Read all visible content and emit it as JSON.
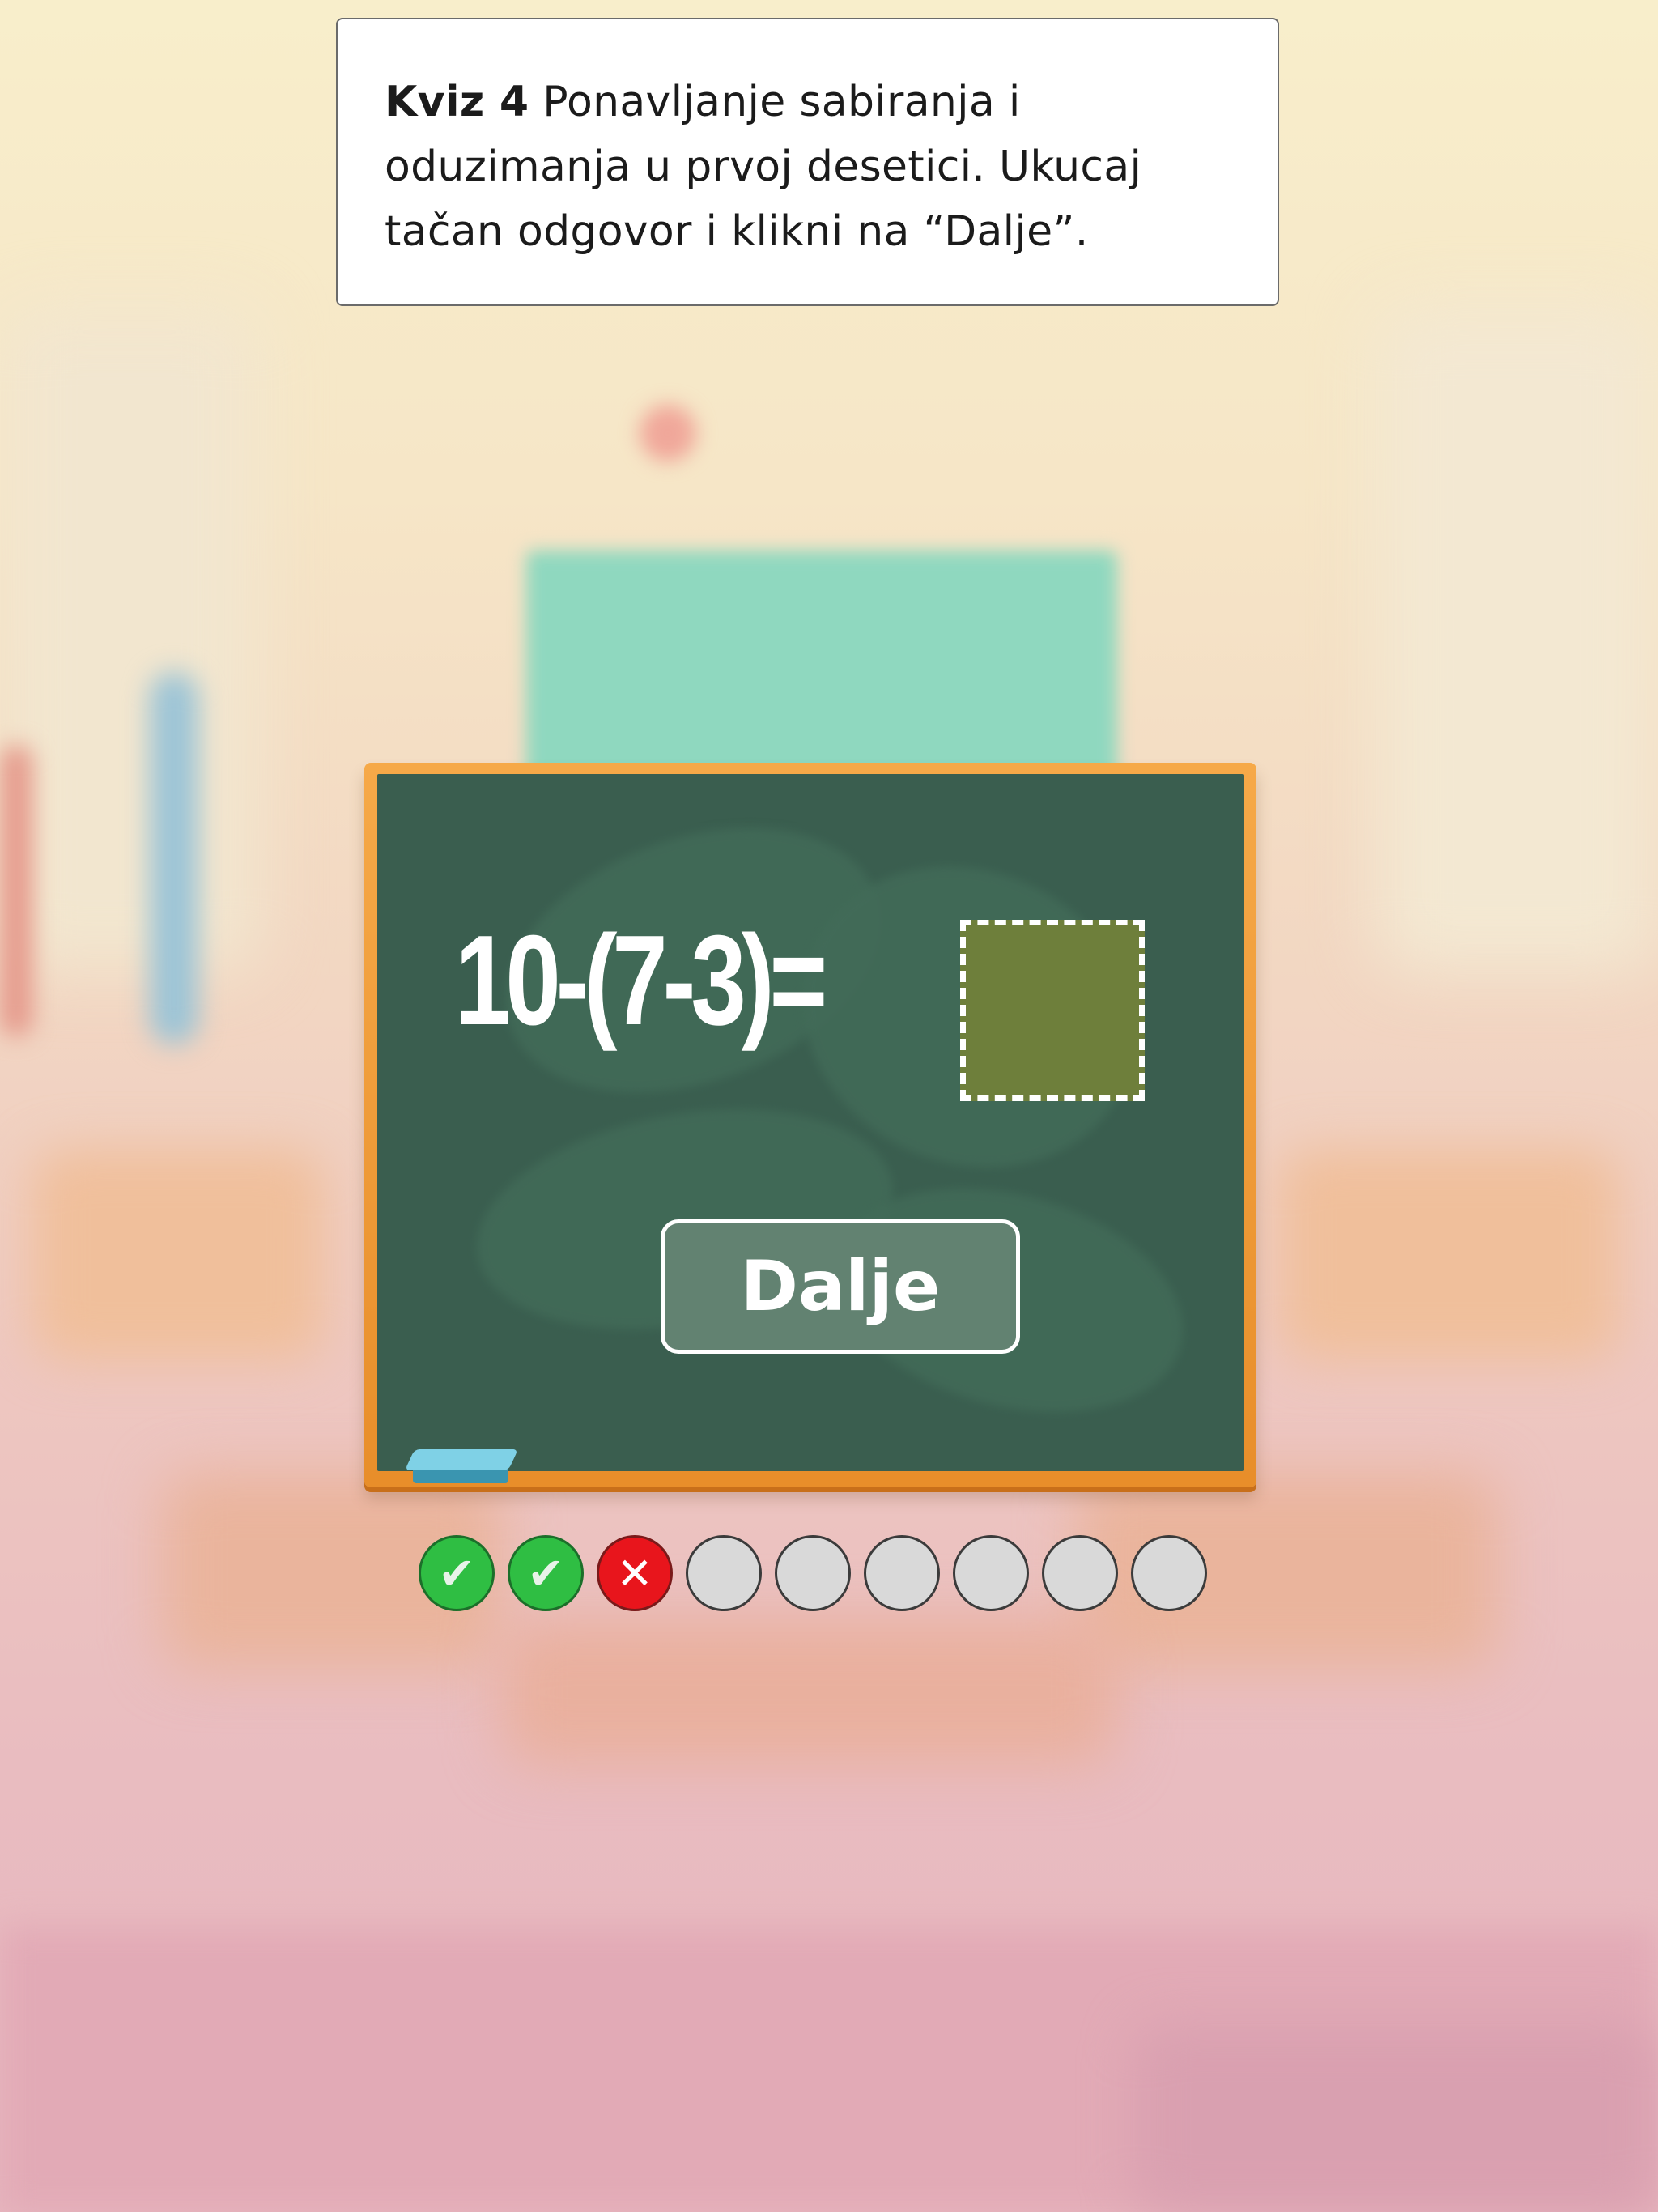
{
  "instruction": {
    "quiz_label": "Kviz 4",
    "text": " Ponavljanje sabiranja i oduzimanja u prvoj desetici. Ukucaj tačan odgovor i klikni na “Dalje”."
  },
  "board": {
    "equation": "10-(7-3)=",
    "answer_value": "",
    "next_button_label": "Dalje"
  },
  "progress": {
    "total": 9,
    "states": [
      "correct",
      "correct",
      "wrong",
      "pending",
      "pending",
      "pending",
      "pending",
      "pending",
      "pending"
    ],
    "correct_symbol": "✔",
    "wrong_symbol": "✕"
  },
  "colors": {
    "board_green": "#3a5e4f",
    "frame_orange": "#f6a948",
    "answer_box": "#6e7f3b",
    "correct": "#2fbe43",
    "wrong": "#e8151c",
    "pending": "#d9d9d9"
  }
}
